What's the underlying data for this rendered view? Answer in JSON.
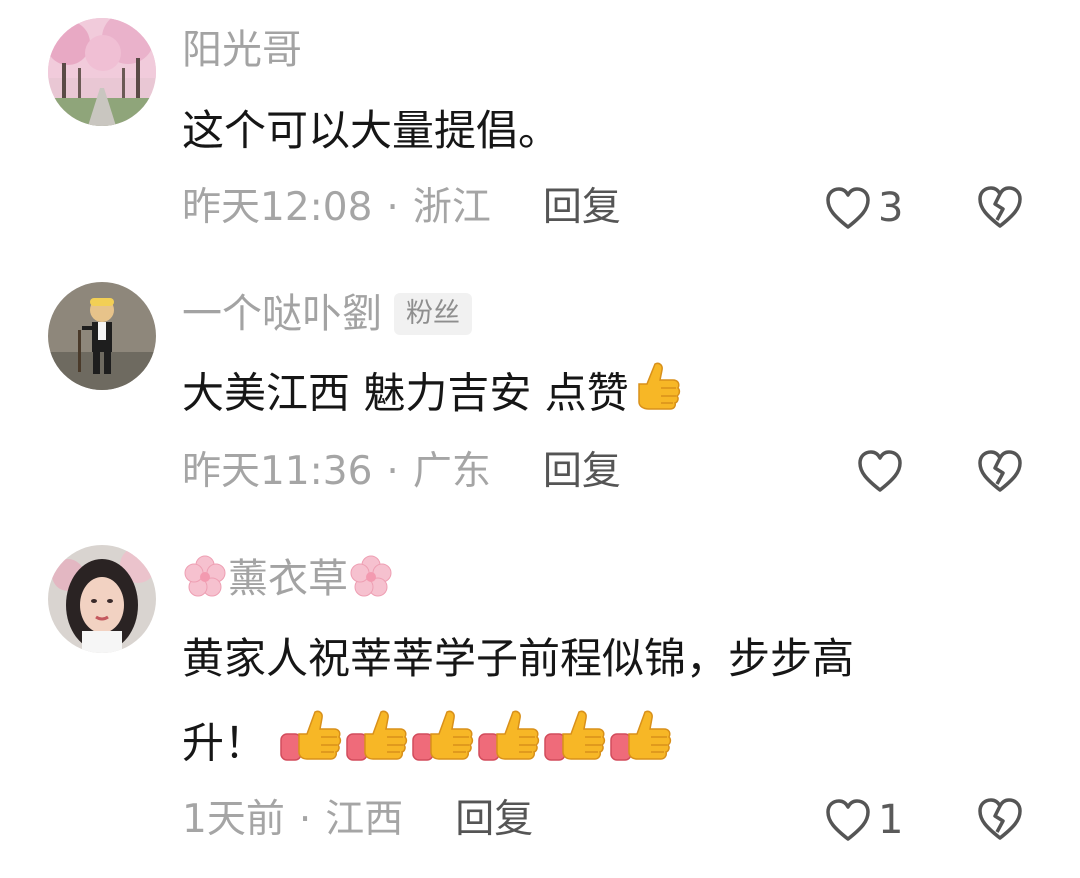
{
  "comments": [
    {
      "username": "阳光哥",
      "text": "这个可以大量提倡。",
      "time": "昨天12:08",
      "location": "浙江",
      "reply_label": "回复",
      "like_count": "3"
    },
    {
      "username": "一个哒卟劉",
      "badge": "粉丝",
      "text": "大美江西 魅力吉安 点赞",
      "time": "昨天11:36",
      "location": "广东",
      "reply_label": "回复",
      "like_count": ""
    },
    {
      "username": "薰衣草",
      "text_line1": "黄家人祝莘莘学子前程似锦，步步高",
      "text_line2": "升！",
      "time": "1天前",
      "location": "江西",
      "reply_label": "回复",
      "like_count": "1"
    }
  ],
  "separator": "·",
  "icons": {
    "like": "heart-outline-icon",
    "dislike": "broken-heart-icon",
    "emoji": "thumbs-up-emoji-icon",
    "name_decoration": "sakura-flower-icon"
  },
  "colors": {
    "text": "#161616",
    "meta": "#a5a5a5",
    "username": "#a3a3a3",
    "thumb_yellow": "#f7b726",
    "thumb_cuff": "#ef6b7a"
  }
}
